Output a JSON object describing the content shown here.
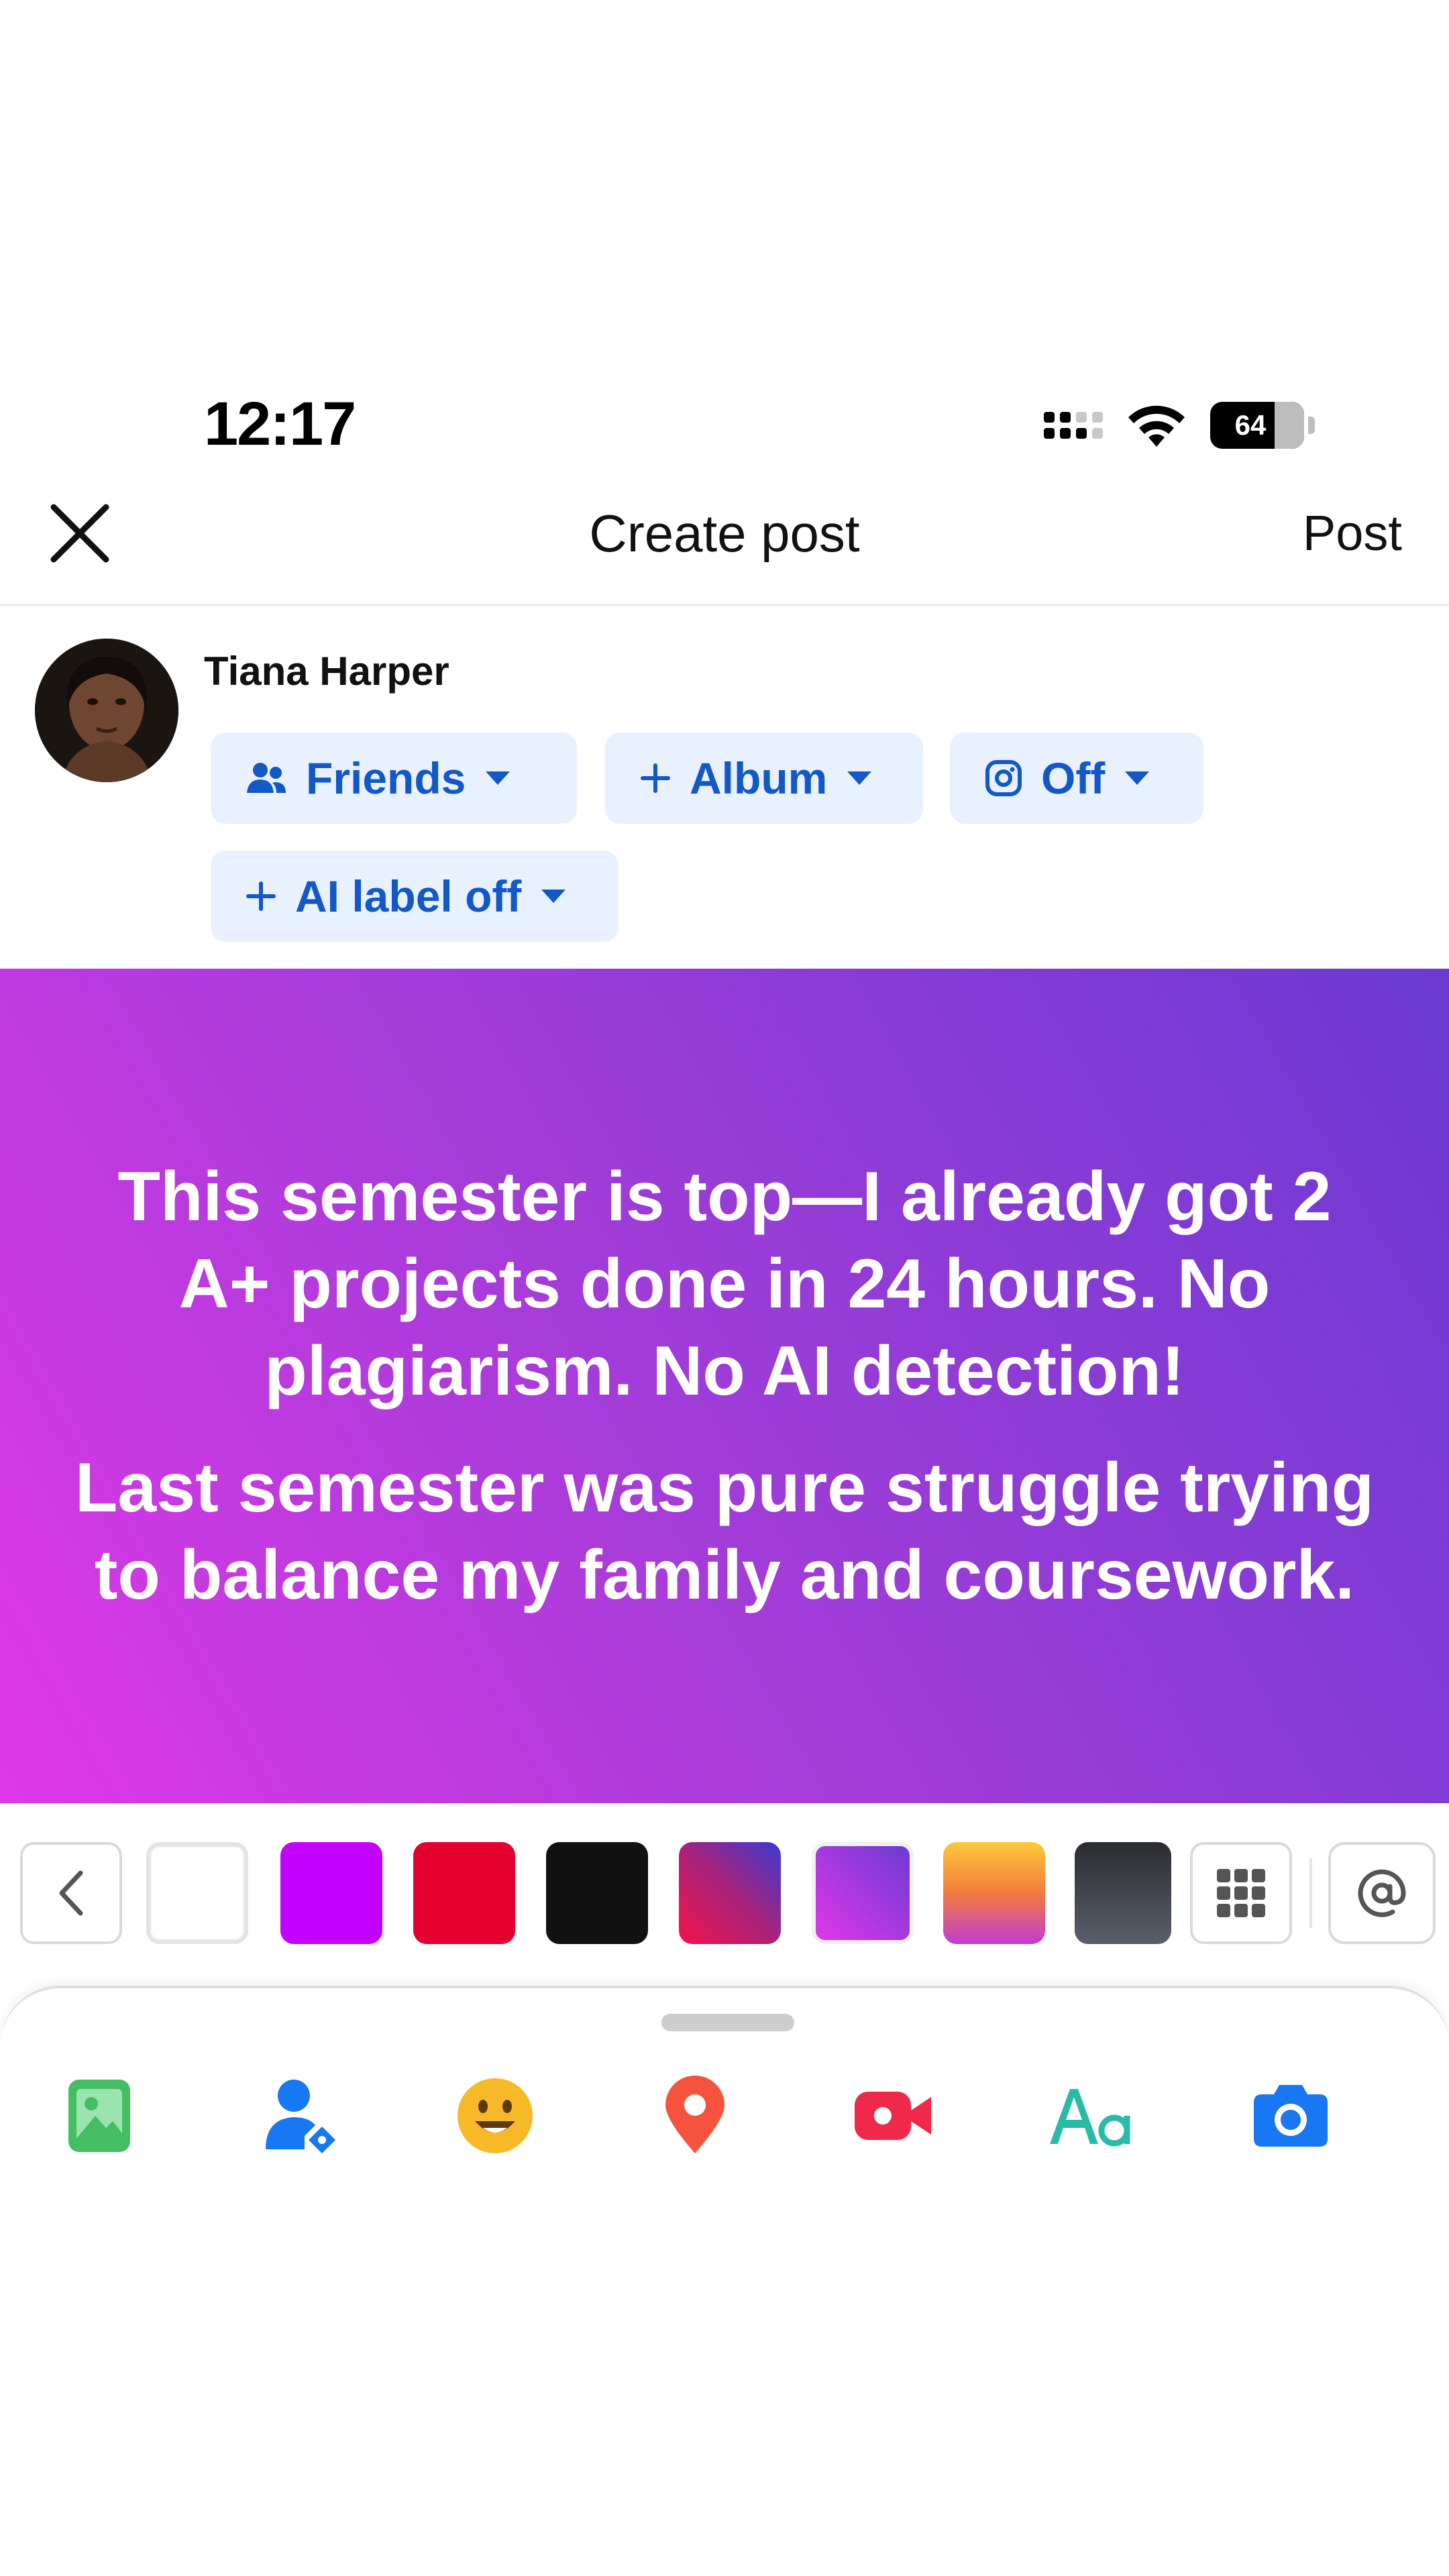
{
  "status_bar": {
    "time": "12:17",
    "battery": "64"
  },
  "header": {
    "title": "Create post",
    "post_label": "Post"
  },
  "author": {
    "name": "Tiana Harper"
  },
  "chips": {
    "audience": "Friends",
    "album": "Album",
    "instagram": "Off",
    "ai_label": "AI label off"
  },
  "post": {
    "paragraph_1": "This semester is top—I already got 2 A+ projects done in 24 hours. No plagiarism. No AI detection!",
    "paragraph_2": "Last semester was pure struggle trying to balance my family and coursework.",
    "background_colors": [
      "#df38e8",
      "#6b3ad2"
    ]
  },
  "background_picker": {
    "swatches": [
      {
        "name": "white",
        "color": "#ffffff"
      },
      {
        "name": "purple",
        "color": "#c400ff"
      },
      {
        "name": "red",
        "color": "#e4002f"
      },
      {
        "name": "black",
        "color": "#111111"
      },
      {
        "name": "pink-blue-gradient",
        "color": "#e0175b"
      },
      {
        "name": "purple-gradient",
        "color": "#8f3ce0"
      },
      {
        "name": "orange-pink-gradient",
        "color": "#f8a03a"
      },
      {
        "name": "dark-gray-gradient",
        "color": "#3a3d46"
      }
    ]
  },
  "actions": [
    {
      "name": "photo-icon",
      "color": "#45bd62"
    },
    {
      "name": "tag-people-icon",
      "color": "#1877f2"
    },
    {
      "name": "feeling-icon",
      "color": "#f7b928"
    },
    {
      "name": "location-icon",
      "color": "#f5533d"
    },
    {
      "name": "live-video-icon",
      "color": "#f02849"
    },
    {
      "name": "text-style-icon",
      "color": "#2abba7"
    },
    {
      "name": "camera-icon",
      "color": "#1877f2"
    }
  ]
}
